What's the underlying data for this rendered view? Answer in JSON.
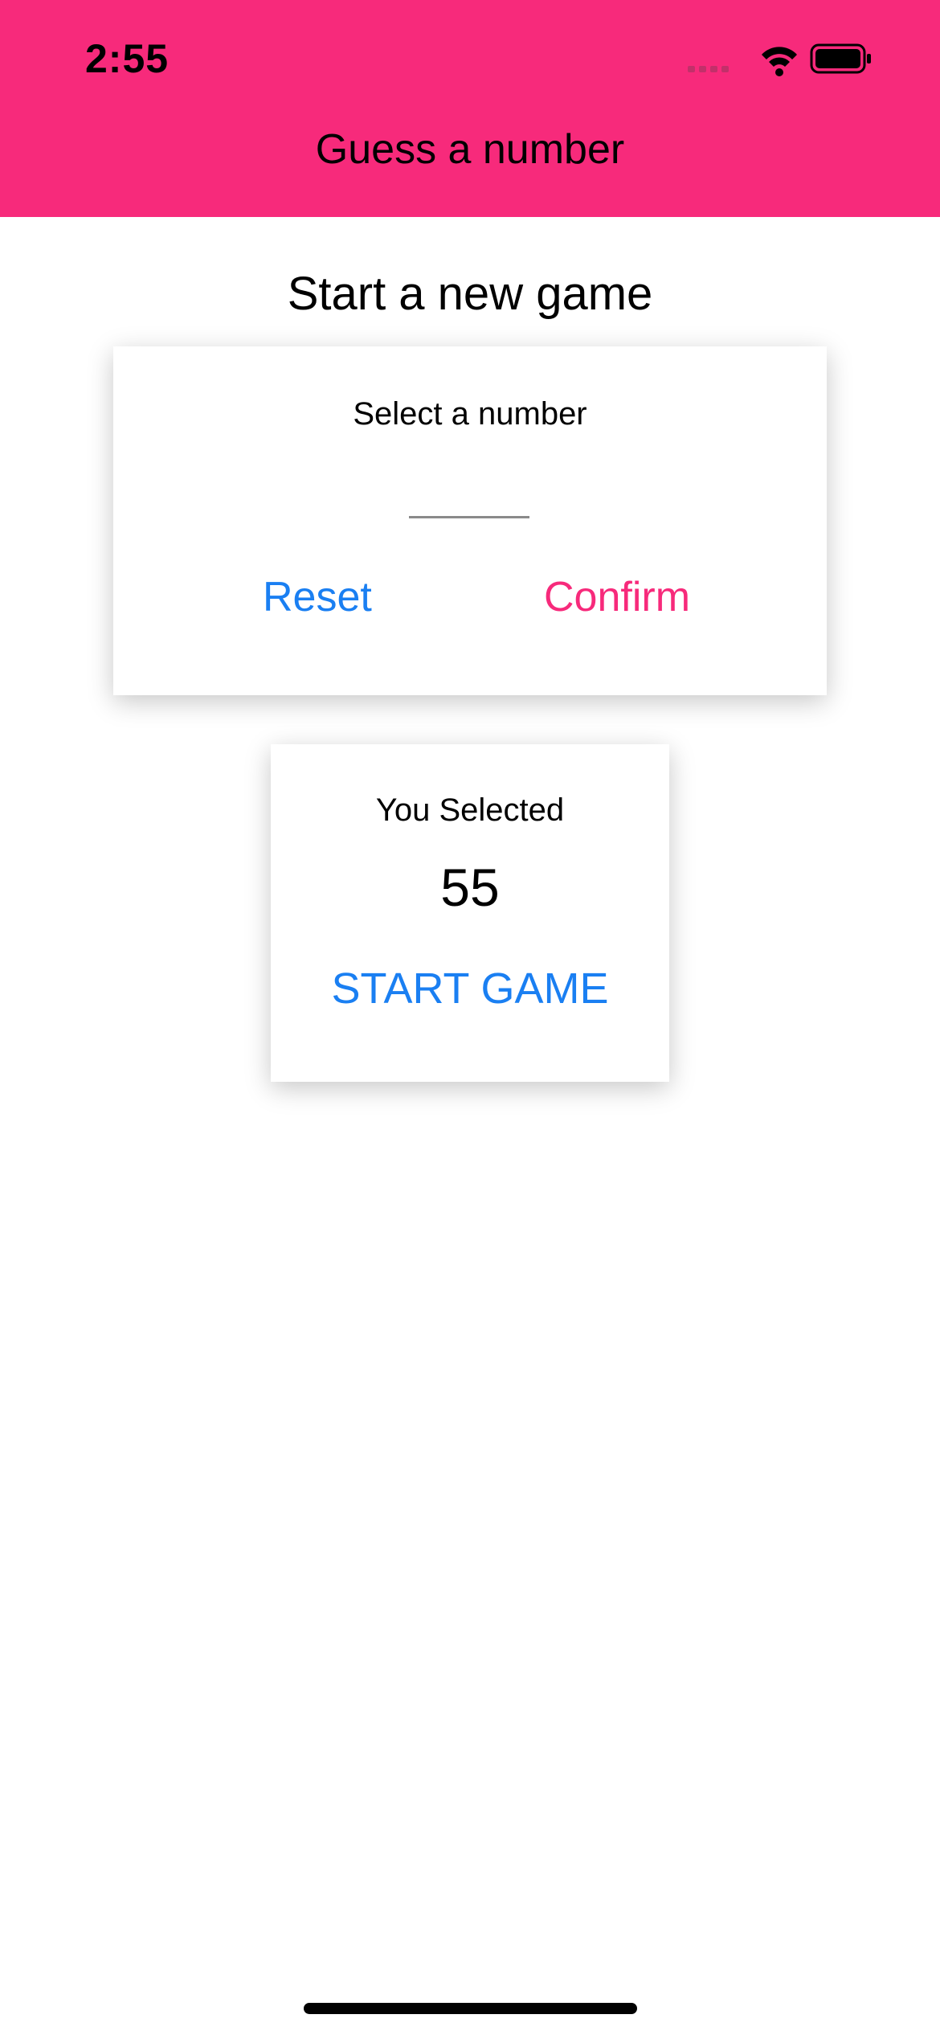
{
  "status_bar": {
    "time": "2:55",
    "icons": [
      "signal-icon",
      "wifi-icon",
      "battery-icon"
    ]
  },
  "header": {
    "title": "Guess a number",
    "color": "#f72a7b"
  },
  "main": {
    "title": "Start a new game",
    "input_card": {
      "label": "Select a number",
      "input_value": "",
      "reset_label": "Reset",
      "confirm_label": "Confirm",
      "reset_color": "#1a7ff2",
      "confirm_color": "#f72a7b"
    },
    "summary_card": {
      "label": "You Selected",
      "selected_number": "55",
      "start_label": "START GAME"
    }
  }
}
